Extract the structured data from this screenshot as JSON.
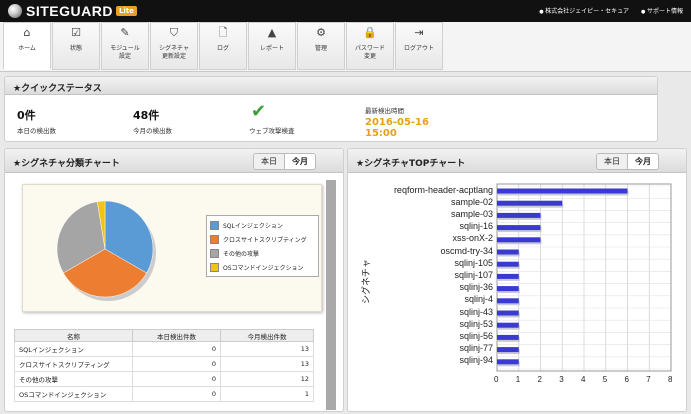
{
  "header": {
    "brand": "SITEGUARD",
    "edition": "Lite",
    "links": [
      "株式会社ジェイピー・セキュア",
      "サポート情報"
    ]
  },
  "tabs": [
    {
      "label": "ホーム",
      "icon": "home-icon",
      "glyph": "⌂"
    },
    {
      "label": "状態",
      "icon": "checkbox-icon",
      "glyph": "☑"
    },
    {
      "label": "モジュール\n設定",
      "icon": "edit-icon",
      "glyph": "✎"
    },
    {
      "label": "シグネチャ\n更新設定",
      "icon": "shield-icon",
      "glyph": "⛉"
    },
    {
      "label": "ログ",
      "icon": "document-icon",
      "glyph": "🗋"
    },
    {
      "label": "レポート",
      "icon": "area-chart-icon",
      "glyph": "▲"
    },
    {
      "label": "管理",
      "icon": "gear-icon",
      "glyph": "⚙"
    },
    {
      "label": "パスワード\n変更",
      "icon": "lock-icon",
      "glyph": "🔒"
    },
    {
      "label": "ログアウト",
      "icon": "logout-icon",
      "glyph": "⇥"
    }
  ],
  "quick_status": {
    "title": "★クイックステータス",
    "today_count": "0件",
    "today_label": "本日の検出数",
    "month_count": "48件",
    "month_label": "今月の検出数",
    "waf_label": "ウェブ攻撃検査",
    "last_label": "最新検出時間",
    "last_date": "2016-05-16",
    "last_time": "15:00"
  },
  "category_chart": {
    "title": "★シグネチャ分類チャート",
    "toggle_today": "本日",
    "toggle_month": "今月",
    "table_headers": [
      "名称",
      "本日検出件数",
      "今月検出件数"
    ],
    "rows": [
      {
        "name": "SQLインジェクション",
        "today": "0",
        "month": "13"
      },
      {
        "name": "クロスサイトスクリプティング",
        "today": "0",
        "month": "13"
      },
      {
        "name": "その他の攻撃",
        "today": "0",
        "month": "12"
      },
      {
        "name": "OSコマンドインジェクション",
        "today": "0",
        "month": "1"
      }
    ]
  },
  "top_chart": {
    "title": "★シグネチャTOPチャート",
    "toggle_today": "本日",
    "toggle_month": "今月"
  },
  "colors": {
    "sql": "#5b9bd5",
    "xss": "#ed7d31",
    "other": "#a5a5a5",
    "os": "#f2c314",
    "bar": "#3a3ad0"
  },
  "chart_data": [
    {
      "type": "pie",
      "categories": [
        "SQLインジェクション",
        "クロスサイトスクリプティング",
        "その他の攻撃",
        "OSコマンドインジェクション"
      ],
      "values": [
        13,
        13,
        12,
        1
      ]
    },
    {
      "type": "bar",
      "orientation": "horizontal",
      "ylabel": "シグネチャ",
      "categories": [
        "reqform-header-acptlang",
        "sample-02",
        "sample-03",
        "sqlinj-16",
        "xss-onX-2",
        "oscmd-try-34",
        "sqlinj-105",
        "sqlinj-107",
        "sqlinj-36",
        "sqlinj-4",
        "sqlinj-43",
        "sqlinj-53",
        "sqlinj-56",
        "sqlinj-77",
        "sqlinj-94"
      ],
      "values": [
        6,
        3,
        2,
        2,
        2,
        1,
        1,
        1,
        1,
        1,
        1,
        1,
        1,
        1,
        1
      ],
      "xlim": [
        0,
        8
      ],
      "xticks": [
        0,
        1,
        2,
        3,
        4,
        5,
        6,
        7,
        8
      ],
      "grid": true
    }
  ]
}
